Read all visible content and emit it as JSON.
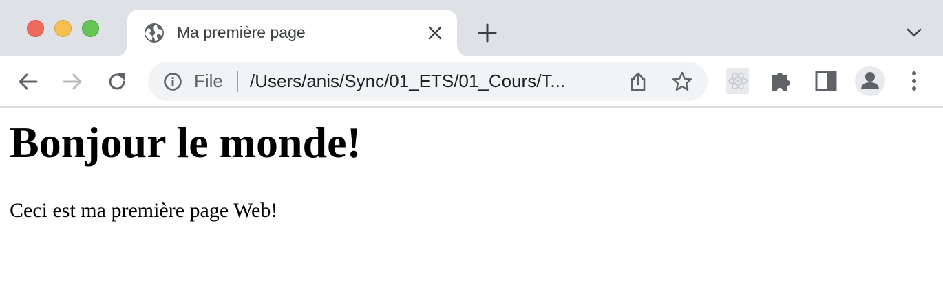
{
  "window": {
    "traffic_lights": {
      "close_color": "#ed6a5e",
      "minimize_color": "#f5bf4f",
      "zoom_color": "#62c554"
    }
  },
  "tab": {
    "title": "Ma première page",
    "favicon": "globe-icon"
  },
  "toolbar": {
    "back_icon": "arrow-left-icon",
    "forward_icon": "arrow-right-icon",
    "reload_icon": "reload-icon"
  },
  "omnibox": {
    "info_icon": "info-icon",
    "scheme_label": "File",
    "url": "/Users/anis/Sync/01_ETS/01_Cours/T...",
    "share_icon": "share-icon",
    "bookmark_icon": "star-icon"
  },
  "extensions": [
    "react-icon",
    "puzzle-icon"
  ],
  "page": {
    "heading": "Bonjour le monde!",
    "paragraph": "Ceci est ma première page Web!"
  },
  "colors": {
    "tabstrip_bg": "#dee1e6",
    "omnibox_bg": "#f1f3f4",
    "icon_gray": "#5f6368"
  }
}
